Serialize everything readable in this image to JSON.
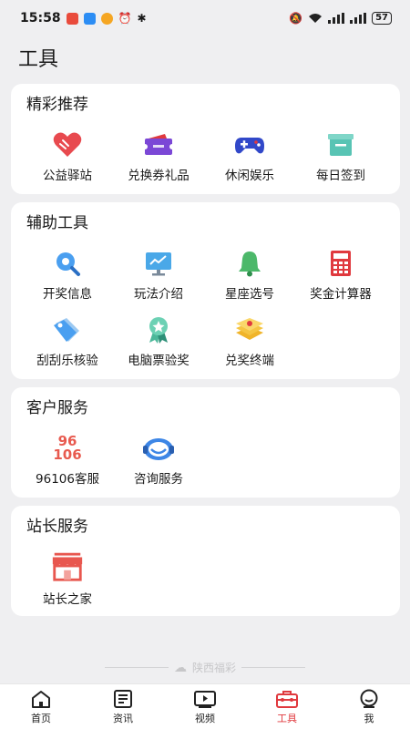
{
  "status_bar": {
    "time": "15:58",
    "battery": "57"
  },
  "page": {
    "title": "工具"
  },
  "sections": {
    "recommend": {
      "title": "精彩推荐",
      "items": [
        {
          "label": "公益驿站",
          "icon": "heart-hands-icon"
        },
        {
          "label": "兑换券礼品",
          "icon": "ticket-icon"
        },
        {
          "label": "休闲娱乐",
          "icon": "gamepad-icon"
        },
        {
          "label": "每日签到",
          "icon": "checkin-icon"
        }
      ]
    },
    "tools": {
      "title": "辅助工具",
      "items": [
        {
          "label": "开奖信息",
          "icon": "search-icon"
        },
        {
          "label": "玩法介绍",
          "icon": "monitor-icon"
        },
        {
          "label": "星座选号",
          "icon": "bell-icon"
        },
        {
          "label": "奖金计算器",
          "icon": "calculator-icon"
        },
        {
          "label": "刮刮乐核验",
          "icon": "tag-icon"
        },
        {
          "label": "电脑票验奖",
          "icon": "award-icon"
        },
        {
          "label": "兑奖终端",
          "icon": "layers-icon"
        }
      ]
    },
    "service": {
      "title": "客户服务",
      "items": [
        {
          "label": "96106客服",
          "icon": "hotline-icon",
          "icon_text_1": "96",
          "icon_text_2": "106"
        },
        {
          "label": "咨询服务",
          "icon": "headset-icon"
        }
      ]
    },
    "station": {
      "title": "站长服务",
      "items": [
        {
          "label": "站长之家",
          "icon": "store-icon"
        }
      ]
    }
  },
  "footer": {
    "brand": "陕西福彩"
  },
  "tabbar": {
    "tabs": [
      {
        "label": "首页",
        "icon": "home-icon"
      },
      {
        "label": "资讯",
        "icon": "news-icon"
      },
      {
        "label": "视频",
        "icon": "video-icon"
      },
      {
        "label": "工具",
        "icon": "toolbox-icon",
        "active": true
      },
      {
        "label": "我",
        "icon": "profile-icon"
      }
    ]
  },
  "colors": {
    "accent": "#e0393e",
    "background": "#efeff1",
    "card": "#ffffff"
  }
}
